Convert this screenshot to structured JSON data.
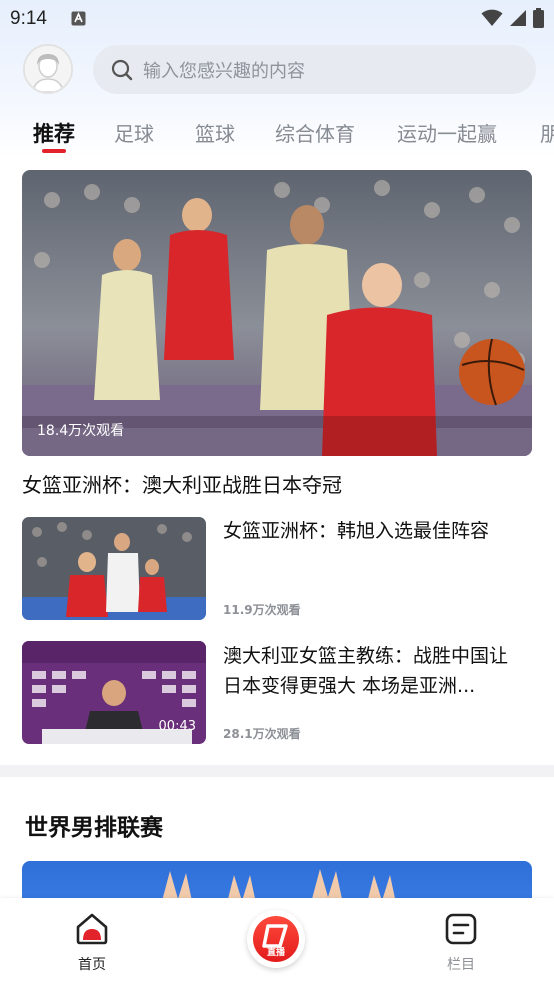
{
  "status_bar": {
    "time": "9:14"
  },
  "search": {
    "placeholder": "输入您感兴趣的内容"
  },
  "tabs": [
    {
      "label": "推荐",
      "active": true
    },
    {
      "label": "足球"
    },
    {
      "label": "篮球"
    },
    {
      "label": "综合体育"
    },
    {
      "label": "运动一起赢"
    },
    {
      "label": "朋"
    }
  ],
  "feed": {
    "hero": {
      "title": "女篮亚洲杯：澳大利亚战胜日本夺冠",
      "views": "18.4万次观看"
    },
    "items": [
      {
        "title": "女篮亚洲杯：韩旭入选最佳阵容",
        "views": "11.9万次观看"
      },
      {
        "title": "澳大利亚女篮主教练：战胜中国让日本变得更强大 本场是亚洲...",
        "views": "28.1万次观看",
        "duration": "00:43"
      }
    ]
  },
  "section": {
    "title": "世界男排联赛"
  },
  "bottom_nav": {
    "home_label": "首页",
    "live_label": "直播",
    "columns_label": "栏目"
  },
  "colors": {
    "accent": "#e3232c",
    "search_bg": "#e7eaf0",
    "header_bg": "#e6effc"
  }
}
